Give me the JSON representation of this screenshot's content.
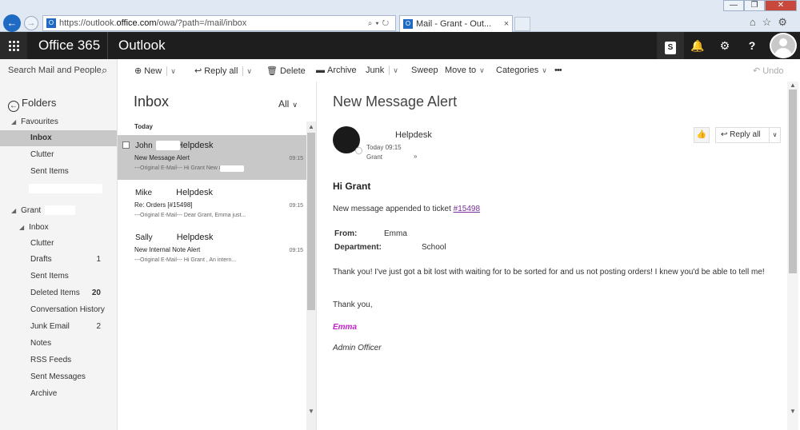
{
  "browser": {
    "url_prefix": "https://outlook.",
    "url_domain": "office.com",
    "url_suffix": "/owa/?path=/mail/inbox",
    "tab_title": "Mail - Grant            - Out...",
    "favicon_letter": "O",
    "win_minimize": "—",
    "win_restore": "❐",
    "win_close": "✕",
    "back_icon": "←",
    "forward_icon": "→",
    "address_icons": "⌕▾↻",
    "tab_close": "×",
    "toolbar_icons": "⌂☆⚙"
  },
  "header": {
    "suite_name": "Office 365",
    "app_name": "Outlook",
    "skype_letter": "S",
    "bell": "🔔",
    "gear": "⚙",
    "help": "?"
  },
  "search": {
    "placeholder": "Search Mail and People",
    "icon": "⌕"
  },
  "commands": {
    "new": "New",
    "reply_all": "Reply all",
    "delete": "Delete",
    "archive": "Archive",
    "junk": "Junk",
    "sweep": "Sweep",
    "move_to": "Move to",
    "categories": "Categories",
    "more": "•••",
    "undo": "Undo",
    "new_icon": "⊕",
    "reply_icon": "↩",
    "delete_icon": "🗑",
    "archive_icon": "▬",
    "undo_icon": "↶",
    "caret": "∨"
  },
  "folders": {
    "header": "Folders",
    "back_icon": "←",
    "favourites_label": "Favourites",
    "favourites": [
      {
        "label": "Inbox",
        "count": ""
      },
      {
        "label": "Clutter",
        "count": ""
      },
      {
        "label": "Sent Items",
        "count": ""
      }
    ],
    "account_label": "Grant",
    "inbox_label": "Inbox",
    "items": [
      {
        "label": "Clutter",
        "count": ""
      },
      {
        "label": "Drafts",
        "count": "1"
      },
      {
        "label": "Sent Items",
        "count": ""
      },
      {
        "label": "Deleted Items",
        "count": "20"
      },
      {
        "label": "Conversation History",
        "count": ""
      },
      {
        "label": "Junk Email",
        "count": "2"
      },
      {
        "label": "Notes",
        "count": ""
      },
      {
        "label": "RSS Feeds",
        "count": ""
      },
      {
        "label": "Sent Messages",
        "count": ""
      },
      {
        "label": "Archive",
        "count": ""
      }
    ]
  },
  "message_list": {
    "title": "Inbox",
    "filter": "All",
    "group": "Today",
    "messages": [
      {
        "sender_first": "John",
        "sender_last": "Helpdesk",
        "subject": "New Message Alert",
        "time": "09:15",
        "preview": "---Original E-Mail--- Hi Grant                    New mes..."
      },
      {
        "sender_first": "Mike",
        "sender_last": "Helpdesk",
        "subject": "Re: Orders [#15498]",
        "time": "09:15",
        "preview": "---Original E-Mail--- Dear Grant, Emma          just..."
      },
      {
        "sender_first": "Sally",
        "sender_last": "Helpdesk",
        "subject": "New Internal Note Alert",
        "time": "09:15",
        "preview": "---Original E-Mail--- Hi Grant              , An intern..."
      }
    ]
  },
  "reading_pane": {
    "subject": "New Message Alert",
    "sender": "Helpdesk",
    "date": "Today 09:15",
    "to": "Grant",
    "expand_icon": "»",
    "like_icon": "👍",
    "reply_all": "Reply all",
    "reply_icon": "↩",
    "greeting": "Hi Grant",
    "intro": "New message appended to ticket ",
    "ticket_link": "#15498",
    "from_label": "From:",
    "from_value": "Emma",
    "department_label": "Department:",
    "department_value": "School",
    "message": "Thank you! I've just got a bit lost with waiting for        to be sorted for       and us not posting orders! I knew you'd be able to tell me!",
    "thanks": "Thank you,",
    "signature_name": "Emma",
    "signature_title": "Admin Officer"
  },
  "colors": {
    "accent": "#1f6ac2",
    "header_bg": "#1e1e1e",
    "selected": "#c8c8c8",
    "signature": "#c020c8",
    "link": "#7a2f9a"
  }
}
